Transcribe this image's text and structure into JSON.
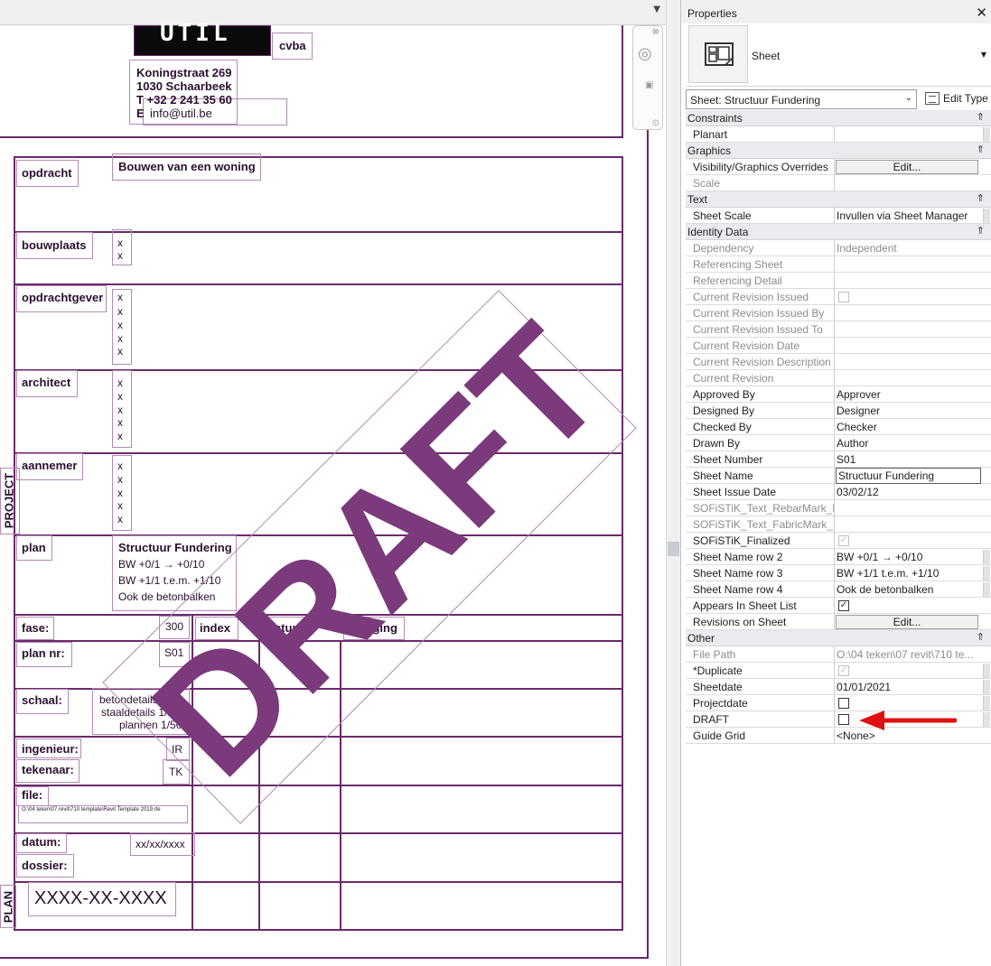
{
  "canvas": {
    "logo_suffix": "cvba",
    "address": [
      "Koningstraat 269",
      "1030 Schaarbeek",
      "T +32 2 241 35 60",
      "E"
    ],
    "email": "info@util.be",
    "vertical_project": "PROJECT",
    "vertical_plan": "PLAN",
    "labels": {
      "opdracht": "opdracht",
      "bouwplaats": "bouwplaats",
      "opdrachtgever": "opdrachtgever",
      "architect": "architect",
      "aannemer": "aannemer",
      "plan": "plan",
      "fase": "fase:",
      "plan_nr": "plan nr:",
      "schaal": "schaal:",
      "ingenieur": "ingenieur:",
      "tekenaar": "tekenaar:",
      "file": "file:",
      "datum": "datum:",
      "dossier": "dossier:",
      "index": "index",
      "datum_col": "datum",
      "wijziging": "wijziging"
    },
    "values": {
      "opdracht": "Bouwen van een woning",
      "plan_lines": [
        "Structuur Fundering",
        "BW +0/1 → +0/10",
        "BW +1/1 t.e.m. +1/10",
        "Ook de betonbalken"
      ],
      "fase": "300",
      "plan_nr": "S01",
      "schaal_lines": [
        "betondetails 1/20",
        "staaldetails 1/10",
        "plannen 1/50"
      ],
      "ingenieur": "IR",
      "tekenaar": "TK",
      "file_path": "O:\\04 teken\\07 revit\\710 template\\Revit Template 2019.rte",
      "datum": "xx/xx/xxxx",
      "dossier": "XXXX-XX-XXXX",
      "x": "x"
    },
    "watermark": "DRAFT"
  },
  "properties": {
    "title": "Properties",
    "close": "✕",
    "type_name": "Sheet",
    "instance_selector": "Sheet: Structuur Fundering",
    "edit_type": "Edit Type",
    "categories": [
      {
        "name": "Constraints",
        "rows": [
          {
            "key": "Planart",
            "value": "",
            "kind": "text",
            "scroll": true
          }
        ]
      },
      {
        "name": "Graphics",
        "rows": [
          {
            "key": "Visibility/Graphics Overrides",
            "value": "Edit...",
            "kind": "button"
          },
          {
            "key": "Scale",
            "value": "",
            "kind": "text",
            "ro": true
          }
        ]
      },
      {
        "name": "Text",
        "rows": [
          {
            "key": "Sheet Scale",
            "value": "Invullen via Sheet Manager",
            "kind": "text",
            "scroll": true
          }
        ]
      },
      {
        "name": "Identity Data",
        "rows": [
          {
            "key": "Dependency",
            "value": "Independent",
            "kind": "text",
            "ro": true
          },
          {
            "key": "Referencing Sheet",
            "value": "",
            "kind": "text",
            "ro": true
          },
          {
            "key": "Referencing Detail",
            "value": "",
            "kind": "text",
            "ro": true
          },
          {
            "key": "Current Revision Issued",
            "value": "",
            "kind": "check",
            "checked": false,
            "ro": true
          },
          {
            "key": "Current Revision Issued By",
            "value": "",
            "kind": "text",
            "ro": true
          },
          {
            "key": "Current Revision Issued To",
            "value": "",
            "kind": "text",
            "ro": true
          },
          {
            "key": "Current Revision Date",
            "value": "",
            "kind": "text",
            "ro": true
          },
          {
            "key": "Current Revision Description",
            "value": "",
            "kind": "text",
            "ro": true
          },
          {
            "key": "Current Revision",
            "value": "",
            "kind": "text",
            "ro": true
          },
          {
            "key": "Approved By",
            "value": "Approver",
            "kind": "text"
          },
          {
            "key": "Designed By",
            "value": "Designer",
            "kind": "text"
          },
          {
            "key": "Checked By",
            "value": "Checker",
            "kind": "text"
          },
          {
            "key": "Drawn By",
            "value": "Author",
            "kind": "text"
          },
          {
            "key": "Sheet Number",
            "value": "S01",
            "kind": "text"
          },
          {
            "key": "Sheet Name",
            "value": "Structuur Fundering",
            "kind": "editing"
          },
          {
            "key": "Sheet Issue Date",
            "value": "03/02/12",
            "kind": "text"
          },
          {
            "key": "SOFiSTiK_Text_RebarMark_L...",
            "value": "",
            "kind": "text",
            "ro": true
          },
          {
            "key": "SOFiSTiK_Text_FabricMark_...",
            "value": "",
            "kind": "text",
            "ro": true
          },
          {
            "key": "SOFiSTiK_Finalized",
            "value": "",
            "kind": "check",
            "checked": true,
            "ro_check": true
          },
          {
            "key": "Sheet Name row 2",
            "value": "BW +0/1 → +0/10",
            "kind": "text",
            "scroll": true
          },
          {
            "key": "Sheet Name row 3",
            "value": "BW +1/1 t.e.m. +1/10",
            "kind": "text",
            "scroll": true
          },
          {
            "key": "Sheet Name row 4",
            "value": "Ook de betonbalken",
            "kind": "text",
            "scroll": true
          },
          {
            "key": "Appears In Sheet List",
            "value": "",
            "kind": "check",
            "checked": true
          },
          {
            "key": "Revisions on Sheet",
            "value": "Edit...",
            "kind": "button"
          }
        ]
      },
      {
        "name": "Other",
        "rows": [
          {
            "key": "File Path",
            "value": "O:\\04 teken\\07 revit\\710 te...",
            "kind": "text",
            "ro": true
          },
          {
            "key": "*Duplicate",
            "value": "",
            "kind": "check",
            "checked": true,
            "ro_check": true,
            "scroll": true
          },
          {
            "key": "Sheetdate",
            "value": "01/01/2021",
            "kind": "text",
            "scroll": true
          },
          {
            "key": "Projectdate",
            "value": "",
            "kind": "check",
            "checked": false,
            "scroll": true
          },
          {
            "key": "DRAFT",
            "value": "",
            "kind": "check",
            "checked": false,
            "scroll": true
          },
          {
            "key": "Guide Grid",
            "value": "<None>",
            "kind": "text"
          }
        ]
      }
    ],
    "collapse_glyph": "⇑",
    "check_glyph": "✓",
    "annotation_color": "#e01010",
    "accent_color": "#6b2a6b"
  }
}
